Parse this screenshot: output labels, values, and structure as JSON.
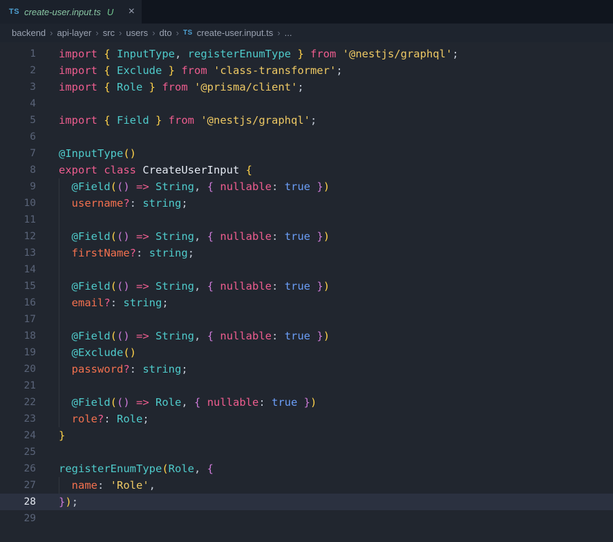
{
  "tab": {
    "icon_label": "TS",
    "title": "create-user.input.ts",
    "git_status": "U",
    "close_glyph": "×"
  },
  "breadcrumb": {
    "items": [
      "backend",
      "api-layer",
      "src",
      "users",
      "dto"
    ],
    "file": "create-user.input.ts",
    "separator": "›",
    "overflow": "..."
  },
  "colors": {
    "ui": {
      "editor_bg": "#21262f",
      "chrome_bg": "#10151e",
      "tab_bg": "#1b212b",
      "breadcrumb_bg": "#1e242e",
      "active_line_bg": "#2b3140",
      "line_number": "#5a6479",
      "line_number_active": "#e6eaf2",
      "breadcrumb_fg": "#9aa2b1",
      "breadcrumb_sep": "#666e7e",
      "tab_title_fg": "#8bc8a5",
      "git_untracked": "#73c991",
      "ts_icon_blue": "#4ea1d3",
      "close_fg": "#9aa2b2",
      "indent_guide": "rgba(255,255,255,0.08)"
    },
    "syntax": {
      "kw": "#ee5d8f",
      "str": "#eec964",
      "typ": "#4fcbcb",
      "prop": "#f4714f",
      "const": "#6b9ef7",
      "pl": "#c3cad6",
      "b1": "#ffd24a",
      "b2": "#cd7ad8",
      "cls": "#e4e9f2"
    }
  },
  "editor": {
    "active_line": 28,
    "lines": [
      {
        "n": 1,
        "guide": false,
        "tokens": [
          {
            "c": "kw",
            "t": "import "
          },
          {
            "c": "b1",
            "t": "{ "
          },
          {
            "c": "typ",
            "t": "InputType"
          },
          {
            "c": "pl",
            "t": ", "
          },
          {
            "c": "typ",
            "t": "registerEnumType"
          },
          {
            "c": "b1",
            "t": " }"
          },
          {
            "c": "kw",
            "t": " from "
          },
          {
            "c": "str",
            "t": "'@nestjs/graphql'"
          },
          {
            "c": "pl",
            "t": ";"
          }
        ]
      },
      {
        "n": 2,
        "guide": false,
        "tokens": [
          {
            "c": "kw",
            "t": "import "
          },
          {
            "c": "b1",
            "t": "{ "
          },
          {
            "c": "typ",
            "t": "Exclude"
          },
          {
            "c": "b1",
            "t": " }"
          },
          {
            "c": "kw",
            "t": " from "
          },
          {
            "c": "str",
            "t": "'class-transformer'"
          },
          {
            "c": "pl",
            "t": ";"
          }
        ]
      },
      {
        "n": 3,
        "guide": false,
        "tokens": [
          {
            "c": "kw",
            "t": "import "
          },
          {
            "c": "b1",
            "t": "{ "
          },
          {
            "c": "typ",
            "t": "Role"
          },
          {
            "c": "b1",
            "t": " }"
          },
          {
            "c": "kw",
            "t": " from "
          },
          {
            "c": "str",
            "t": "'@prisma/client'"
          },
          {
            "c": "pl",
            "t": ";"
          }
        ]
      },
      {
        "n": 4,
        "guide": false,
        "tokens": []
      },
      {
        "n": 5,
        "guide": false,
        "tokens": [
          {
            "c": "kw",
            "t": "import "
          },
          {
            "c": "b1",
            "t": "{ "
          },
          {
            "c": "typ",
            "t": "Field"
          },
          {
            "c": "b1",
            "t": " }"
          },
          {
            "c": "kw",
            "t": " from "
          },
          {
            "c": "str",
            "t": "'@nestjs/graphql'"
          },
          {
            "c": "pl",
            "t": ";"
          }
        ]
      },
      {
        "n": 6,
        "guide": false,
        "tokens": []
      },
      {
        "n": 7,
        "guide": false,
        "tokens": [
          {
            "c": "typ",
            "t": "@InputType"
          },
          {
            "c": "b1",
            "t": "()"
          }
        ]
      },
      {
        "n": 8,
        "guide": false,
        "tokens": [
          {
            "c": "kw",
            "t": "export class "
          },
          {
            "c": "cls",
            "t": "CreateUserInput "
          },
          {
            "c": "b1",
            "t": "{"
          }
        ]
      },
      {
        "n": 9,
        "guide": true,
        "tokens": [
          {
            "c": "pl",
            "t": "  "
          },
          {
            "c": "typ",
            "t": "@Field"
          },
          {
            "c": "b1",
            "t": "("
          },
          {
            "c": "b2",
            "t": "()"
          },
          {
            "c": "kw",
            "t": " => "
          },
          {
            "c": "typ",
            "t": "String"
          },
          {
            "c": "pl",
            "t": ", "
          },
          {
            "c": "b2",
            "t": "{ "
          },
          {
            "c": "kw",
            "t": "nullable"
          },
          {
            "c": "pl",
            "t": ": "
          },
          {
            "c": "const",
            "t": "true"
          },
          {
            "c": "b2",
            "t": " }"
          },
          {
            "c": "b1",
            "t": ")"
          }
        ]
      },
      {
        "n": 10,
        "guide": true,
        "tokens": [
          {
            "c": "pl",
            "t": "  "
          },
          {
            "c": "prop",
            "t": "username"
          },
          {
            "c": "kw",
            "t": "?"
          },
          {
            "c": "pl",
            "t": ": "
          },
          {
            "c": "typ",
            "t": "string"
          },
          {
            "c": "pl",
            "t": ";"
          }
        ]
      },
      {
        "n": 11,
        "guide": true,
        "tokens": []
      },
      {
        "n": 12,
        "guide": true,
        "tokens": [
          {
            "c": "pl",
            "t": "  "
          },
          {
            "c": "typ",
            "t": "@Field"
          },
          {
            "c": "b1",
            "t": "("
          },
          {
            "c": "b2",
            "t": "()"
          },
          {
            "c": "kw",
            "t": " => "
          },
          {
            "c": "typ",
            "t": "String"
          },
          {
            "c": "pl",
            "t": ", "
          },
          {
            "c": "b2",
            "t": "{ "
          },
          {
            "c": "kw",
            "t": "nullable"
          },
          {
            "c": "pl",
            "t": ": "
          },
          {
            "c": "const",
            "t": "true"
          },
          {
            "c": "b2",
            "t": " }"
          },
          {
            "c": "b1",
            "t": ")"
          }
        ]
      },
      {
        "n": 13,
        "guide": true,
        "tokens": [
          {
            "c": "pl",
            "t": "  "
          },
          {
            "c": "prop",
            "t": "firstName"
          },
          {
            "c": "kw",
            "t": "?"
          },
          {
            "c": "pl",
            "t": ": "
          },
          {
            "c": "typ",
            "t": "string"
          },
          {
            "c": "pl",
            "t": ";"
          }
        ]
      },
      {
        "n": 14,
        "guide": true,
        "tokens": []
      },
      {
        "n": 15,
        "guide": true,
        "tokens": [
          {
            "c": "pl",
            "t": "  "
          },
          {
            "c": "typ",
            "t": "@Field"
          },
          {
            "c": "b1",
            "t": "("
          },
          {
            "c": "b2",
            "t": "()"
          },
          {
            "c": "kw",
            "t": " => "
          },
          {
            "c": "typ",
            "t": "String"
          },
          {
            "c": "pl",
            "t": ", "
          },
          {
            "c": "b2",
            "t": "{ "
          },
          {
            "c": "kw",
            "t": "nullable"
          },
          {
            "c": "pl",
            "t": ": "
          },
          {
            "c": "const",
            "t": "true"
          },
          {
            "c": "b2",
            "t": " }"
          },
          {
            "c": "b1",
            "t": ")"
          }
        ]
      },
      {
        "n": 16,
        "guide": true,
        "tokens": [
          {
            "c": "pl",
            "t": "  "
          },
          {
            "c": "prop",
            "t": "email"
          },
          {
            "c": "kw",
            "t": "?"
          },
          {
            "c": "pl",
            "t": ": "
          },
          {
            "c": "typ",
            "t": "string"
          },
          {
            "c": "pl",
            "t": ";"
          }
        ]
      },
      {
        "n": 17,
        "guide": true,
        "tokens": []
      },
      {
        "n": 18,
        "guide": true,
        "tokens": [
          {
            "c": "pl",
            "t": "  "
          },
          {
            "c": "typ",
            "t": "@Field"
          },
          {
            "c": "b1",
            "t": "("
          },
          {
            "c": "b2",
            "t": "()"
          },
          {
            "c": "kw",
            "t": " => "
          },
          {
            "c": "typ",
            "t": "String"
          },
          {
            "c": "pl",
            "t": ", "
          },
          {
            "c": "b2",
            "t": "{ "
          },
          {
            "c": "kw",
            "t": "nullable"
          },
          {
            "c": "pl",
            "t": ": "
          },
          {
            "c": "const",
            "t": "true"
          },
          {
            "c": "b2",
            "t": " }"
          },
          {
            "c": "b1",
            "t": ")"
          }
        ]
      },
      {
        "n": 19,
        "guide": true,
        "tokens": [
          {
            "c": "pl",
            "t": "  "
          },
          {
            "c": "typ",
            "t": "@Exclude"
          },
          {
            "c": "b1",
            "t": "()"
          }
        ]
      },
      {
        "n": 20,
        "guide": true,
        "tokens": [
          {
            "c": "pl",
            "t": "  "
          },
          {
            "c": "prop",
            "t": "password"
          },
          {
            "c": "kw",
            "t": "?"
          },
          {
            "c": "pl",
            "t": ": "
          },
          {
            "c": "typ",
            "t": "string"
          },
          {
            "c": "pl",
            "t": ";"
          }
        ]
      },
      {
        "n": 21,
        "guide": true,
        "tokens": []
      },
      {
        "n": 22,
        "guide": true,
        "tokens": [
          {
            "c": "pl",
            "t": "  "
          },
          {
            "c": "typ",
            "t": "@Field"
          },
          {
            "c": "b1",
            "t": "("
          },
          {
            "c": "b2",
            "t": "()"
          },
          {
            "c": "kw",
            "t": " => "
          },
          {
            "c": "typ",
            "t": "Role"
          },
          {
            "c": "pl",
            "t": ", "
          },
          {
            "c": "b2",
            "t": "{ "
          },
          {
            "c": "kw",
            "t": "nullable"
          },
          {
            "c": "pl",
            "t": ": "
          },
          {
            "c": "const",
            "t": "true"
          },
          {
            "c": "b2",
            "t": " }"
          },
          {
            "c": "b1",
            "t": ")"
          }
        ]
      },
      {
        "n": 23,
        "guide": true,
        "tokens": [
          {
            "c": "pl",
            "t": "  "
          },
          {
            "c": "prop",
            "t": "role"
          },
          {
            "c": "kw",
            "t": "?"
          },
          {
            "c": "pl",
            "t": ": "
          },
          {
            "c": "typ",
            "t": "Role"
          },
          {
            "c": "pl",
            "t": ";"
          }
        ]
      },
      {
        "n": 24,
        "guide": false,
        "tokens": [
          {
            "c": "b1",
            "t": "}"
          }
        ]
      },
      {
        "n": 25,
        "guide": false,
        "tokens": []
      },
      {
        "n": 26,
        "guide": false,
        "tokens": [
          {
            "c": "typ",
            "t": "registerEnumType"
          },
          {
            "c": "b1",
            "t": "("
          },
          {
            "c": "typ",
            "t": "Role"
          },
          {
            "c": "pl",
            "t": ", "
          },
          {
            "c": "b2",
            "t": "{"
          }
        ]
      },
      {
        "n": 27,
        "guide": true,
        "tokens": [
          {
            "c": "pl",
            "t": "  "
          },
          {
            "c": "prop",
            "t": "name"
          },
          {
            "c": "pl",
            "t": ": "
          },
          {
            "c": "str",
            "t": "'Role'"
          },
          {
            "c": "pl",
            "t": ","
          }
        ]
      },
      {
        "n": 28,
        "guide": false,
        "tokens": [
          {
            "c": "b2",
            "t": "}"
          },
          {
            "c": "b1",
            "t": ")"
          },
          {
            "c": "pl",
            "t": ";"
          }
        ]
      },
      {
        "n": 29,
        "guide": false,
        "tokens": []
      }
    ]
  }
}
